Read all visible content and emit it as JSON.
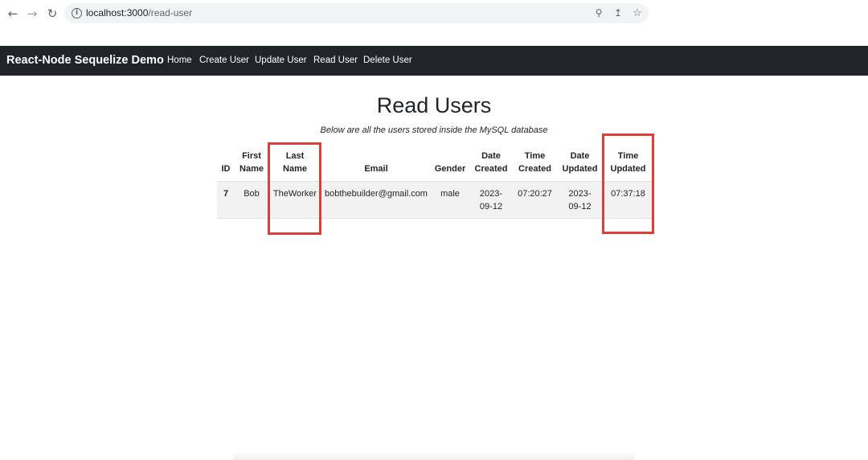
{
  "browser": {
    "url_host": "localhost:3000",
    "url_path": "/read-user"
  },
  "navbar": {
    "brand": "React-Node Sequelize Demo",
    "links": [
      "Home",
      "Create User",
      "Update User",
      "Read User",
      "Delete User"
    ]
  },
  "page": {
    "title": "Read Users",
    "subtitle": "Below are all the users stored inside the MySQL database"
  },
  "table": {
    "headers": [
      [
        "ID"
      ],
      [
        "First",
        "Name"
      ],
      [
        "Last",
        "Name"
      ],
      [
        "Email"
      ],
      [
        "Gender"
      ],
      [
        "Date",
        "Created"
      ],
      [
        "Time",
        "Created"
      ],
      [
        "Date",
        "Updated"
      ],
      [
        "Time",
        "Updated"
      ]
    ],
    "rows": [
      {
        "id": "7",
        "first_name": "Bob",
        "last_name": "TheWorker",
        "email": "bobthebuilder@gmail.com",
        "gender": "male",
        "date_created": [
          "2023-",
          "09-12"
        ],
        "time_created": "07:20:27",
        "date_updated": [
          "2023-",
          "09-12"
        ],
        "time_updated": "07:37:18"
      }
    ]
  },
  "annotations": {
    "highlight_color": "#d9403a"
  }
}
